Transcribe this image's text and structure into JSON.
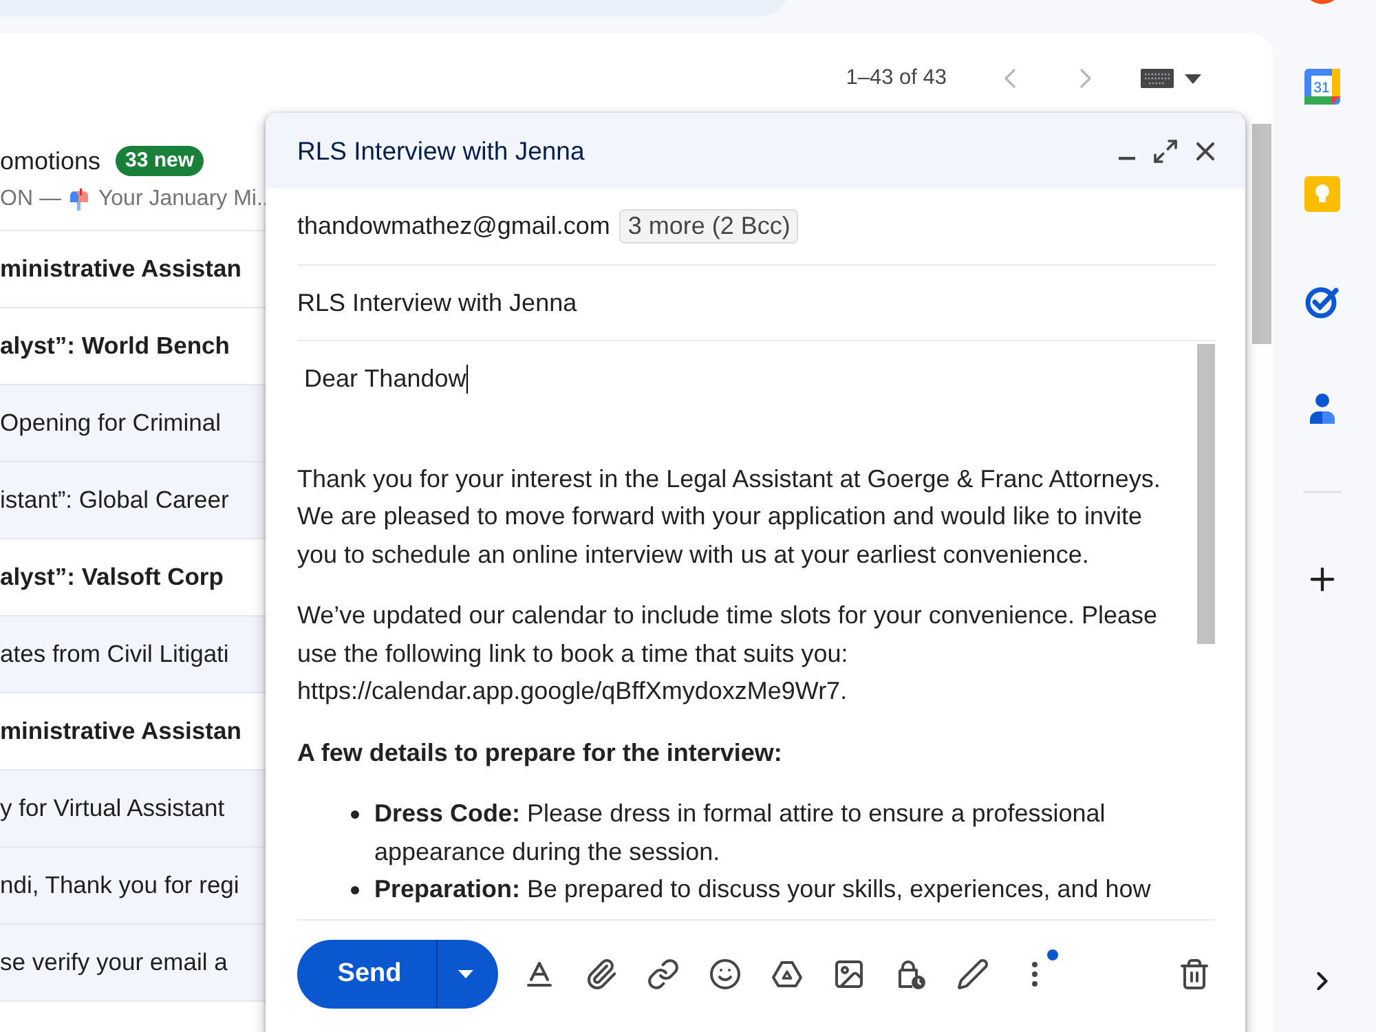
{
  "pager": {
    "range": "1–43 of 43",
    "previous": {
      "disabled": true
    },
    "next": {
      "disabled": true
    }
  },
  "inbox_rows": [
    {
      "kind": "category",
      "label": "omotions",
      "badge": "33 new",
      "sender": "ON —",
      "snippet": "Your January Mi.."
    },
    {
      "kind": "email",
      "text": "ministrative Assistan",
      "unread": true
    },
    {
      "kind": "email",
      "text": "alyst”: World Bench",
      "unread": true
    },
    {
      "kind": "email",
      "text": "Opening for Criminal",
      "unread": false
    },
    {
      "kind": "email",
      "text": "istant”: Global Career",
      "unread": false
    },
    {
      "kind": "email",
      "text": "alyst”: Valsoft Corp",
      "unread": true
    },
    {
      "kind": "email",
      "text": "ates from Civil Litigati",
      "unread": false
    },
    {
      "kind": "email",
      "text": "ministrative Assistan",
      "unread": true
    },
    {
      "kind": "email",
      "text": "y for Virtual Assistant",
      "unread": false
    },
    {
      "kind": "email",
      "text": "ndi, Thank you for regi",
      "unread": false
    },
    {
      "kind": "email",
      "text": "se verify your email a",
      "unread": false
    }
  ],
  "compose": {
    "title": "RLS Interview with Jenna",
    "to": "thandowmathez@gmail.com",
    "more_recipients": "3 more (2 Bcc)",
    "subject": "RLS Interview with Jenna",
    "body": [
      {
        "kind": "greeting",
        "text": "Dear Thandow",
        "has_cursor": true
      },
      {
        "kind": "paragraph",
        "text": "Thank you for your interest in the Legal Assistant at Goerge & Franc Attorneys. We are pleased to move forward with your application and would like to invite you to schedule an online interview with us at your earliest convenience."
      },
      {
        "kind": "paragraph",
        "text": "We’ve updated our calendar to include time slots for your convenience. Please use the following link to book a time that suits you: https://calendar.app.google/qBffXmydoxzMe9Wr7."
      },
      {
        "kind": "heading",
        "text": "A few details to prepare for the interview:"
      },
      {
        "kind": "bullets",
        "items": [
          "**Dress Code:** Please dress in formal attire to ensure a professional appearance during the session.",
          "**Preparation:** Be prepared to discuss your skills, experiences, and how"
        ]
      }
    ],
    "send": "Send",
    "tools": [
      {
        "kind": "formatting",
        "dot": false
      },
      {
        "kind": "attach",
        "dot": false
      },
      {
        "kind": "link",
        "dot": false
      },
      {
        "kind": "emoji",
        "dot": false
      },
      {
        "kind": "drive",
        "dot": false
      },
      {
        "kind": "photo",
        "dot": false
      },
      {
        "kind": "confidential",
        "dot": false
      },
      {
        "kind": "signature",
        "dot": false
      },
      {
        "kind": "more",
        "dot": true
      },
      {
        "kind": "discard",
        "dot": false
      }
    ]
  },
  "side_apps": [
    {
      "kind": "calendar",
      "day": "31"
    },
    {
      "kind": "keep"
    },
    {
      "kind": "tasks"
    },
    {
      "kind": "contacts"
    }
  ]
}
